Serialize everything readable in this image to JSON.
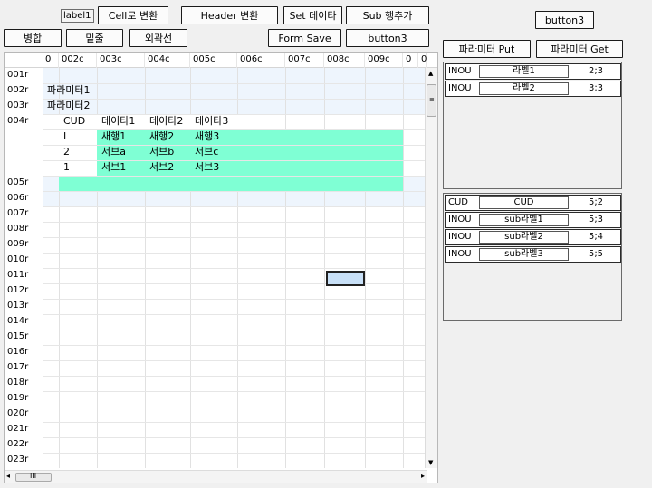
{
  "toolbar": {
    "label1": "label1",
    "cell_convert": "Cell로 변환",
    "header_convert": "Header 변환",
    "set_data": "Set 데이타",
    "sub_add_row": "Sub 행추가",
    "button3_top": "button3",
    "merge": "병합",
    "underline": "밑줄",
    "outline": "외곽선",
    "form_save": "Form Save",
    "button3_mid": "button3",
    "param_put": "파라미터 Put",
    "param_get": "파라미터 Get"
  },
  "grid": {
    "col_headers": [
      "0",
      "002c",
      "003c",
      "004c",
      "005c",
      "006c",
      "007c",
      "008c",
      "009c",
      "0",
      "0"
    ],
    "rows": [
      "001r",
      "002r",
      "003r",
      "004r",
      "005r",
      "006r",
      "007r",
      "008r",
      "009r",
      "010r",
      "011r",
      "012r",
      "013r",
      "014r",
      "015r",
      "016r",
      "017r",
      "018r",
      "019r",
      "020r",
      "021r",
      "022r",
      "023r"
    ],
    "params": [
      "파라미터1",
      "파라미터2"
    ],
    "sub_header": [
      "CUD",
      "데이타1",
      "데이타2",
      "데이타3"
    ],
    "sub_rows": [
      [
        "I",
        "새행1",
        "새행2",
        "새행3"
      ],
      [
        "2",
        "서브a",
        "서브b",
        "서브c"
      ],
      [
        "1",
        "서브1",
        "서브2",
        "서브3"
      ]
    ],
    "hscroll_label": "III"
  },
  "panel1": {
    "rows": [
      {
        "key": "INOU",
        "name": "라벨1",
        "value": "2;3"
      },
      {
        "key": "INOU",
        "name": "라벨2",
        "value": "3;3"
      }
    ]
  },
  "panel2": {
    "rows": [
      {
        "key": "CUD",
        "name": "CUD",
        "value": "5;2"
      },
      {
        "key": "INOU",
        "name": "sub라벨1",
        "value": "5;3"
      },
      {
        "key": "INOU",
        "name": "sub라벨2",
        "value": "5;4"
      },
      {
        "key": "INOU",
        "name": "sub라벨3",
        "value": "5;5"
      }
    ]
  }
}
